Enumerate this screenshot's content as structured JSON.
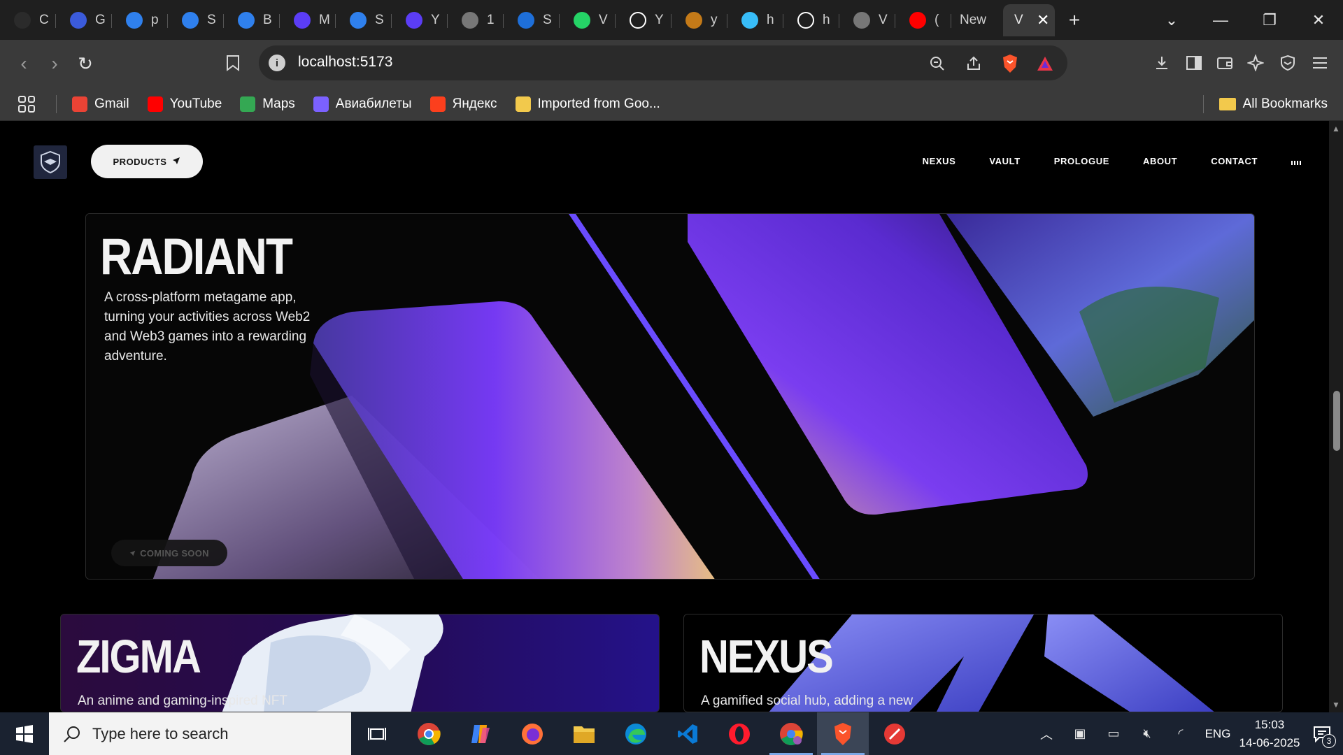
{
  "browser": {
    "tabs": [
      {
        "title": "C",
        "icon": "openai-icon",
        "color": "#2b2b2b"
      },
      {
        "title": "G",
        "icon": "gemini-icon",
        "color": "#3b5bdb"
      },
      {
        "title": "p",
        "icon": "c-logo-icon",
        "color": "#2f80ed"
      },
      {
        "title": "S",
        "icon": "c-logo-icon",
        "color": "#2f80ed"
      },
      {
        "title": "B",
        "icon": "c-logo-icon",
        "color": "#2f80ed"
      },
      {
        "title": "M",
        "icon": "video-icon",
        "color": "#5b3df5"
      },
      {
        "title": "S",
        "icon": "c-logo-icon",
        "color": "#2f80ed"
      },
      {
        "title": "Y",
        "icon": "video-icon",
        "color": "#5b3df5"
      },
      {
        "title": "1",
        "icon": "globe-icon",
        "color": "#777777"
      },
      {
        "title": "S",
        "icon": "app-icon",
        "color": "#1e6fd9"
      },
      {
        "title": "V",
        "icon": "whatsapp-icon",
        "color": "#25d366"
      },
      {
        "title": "Y",
        "icon": "github-icon",
        "color": "#ffffff"
      },
      {
        "title": "y",
        "icon": "app-icon",
        "color": "#c47a18"
      },
      {
        "title": "h",
        "icon": "tailwind-icon",
        "color": "#38bdf8"
      },
      {
        "title": "h",
        "icon": "github-icon",
        "color": "#ffffff"
      },
      {
        "title": "V",
        "icon": "globe-icon",
        "color": "#777777"
      },
      {
        "title": "(",
        "icon": "youtube-icon",
        "color": "#ff0000"
      }
    ],
    "new_tab_label": "New",
    "active_tab_title": "V",
    "url": "localhost:5173",
    "bookmarks": [
      {
        "label": "Gmail",
        "icon": "gmail-icon",
        "color": "#ea4335"
      },
      {
        "label": "YouTube",
        "icon": "youtube-icon",
        "color": "#ff0000"
      },
      {
        "label": "Maps",
        "icon": "maps-icon",
        "color": "#34a853"
      },
      {
        "label": "Авиабилеты",
        "icon": "aviasales-icon",
        "color": "#7b61ff"
      },
      {
        "label": "Яндекс",
        "icon": "yandex-icon",
        "color": "#fc3f1d"
      },
      {
        "label": "Imported from Goo...",
        "icon": "folder-icon",
        "color": "#f2c94c"
      }
    ],
    "all_bookmarks_label": "All Bookmarks"
  },
  "site": {
    "products_label": "PRODUCTS",
    "nav": [
      "NEXUS",
      "VAULT",
      "PROLOGUE",
      "ABOUT",
      "CONTACT"
    ],
    "radiant": {
      "title": "RADIANT",
      "desc_lines": [
        "A cross-platform metagame app,",
        "turning your activities across Web2",
        "and Web3 games into a rewarding",
        "adventure."
      ],
      "badge": "COMING SOON"
    },
    "zigma": {
      "title": "ZIGMA",
      "desc": "An anime and gaming-inspired NFT"
    },
    "nexus": {
      "title": "NEXUS",
      "desc": "A gamified social hub, adding a new"
    }
  },
  "taskbar": {
    "search_placeholder": "Type here to search",
    "language": "ENG",
    "time": "15:03",
    "date": "14-06-2025",
    "notification_count": "3"
  }
}
